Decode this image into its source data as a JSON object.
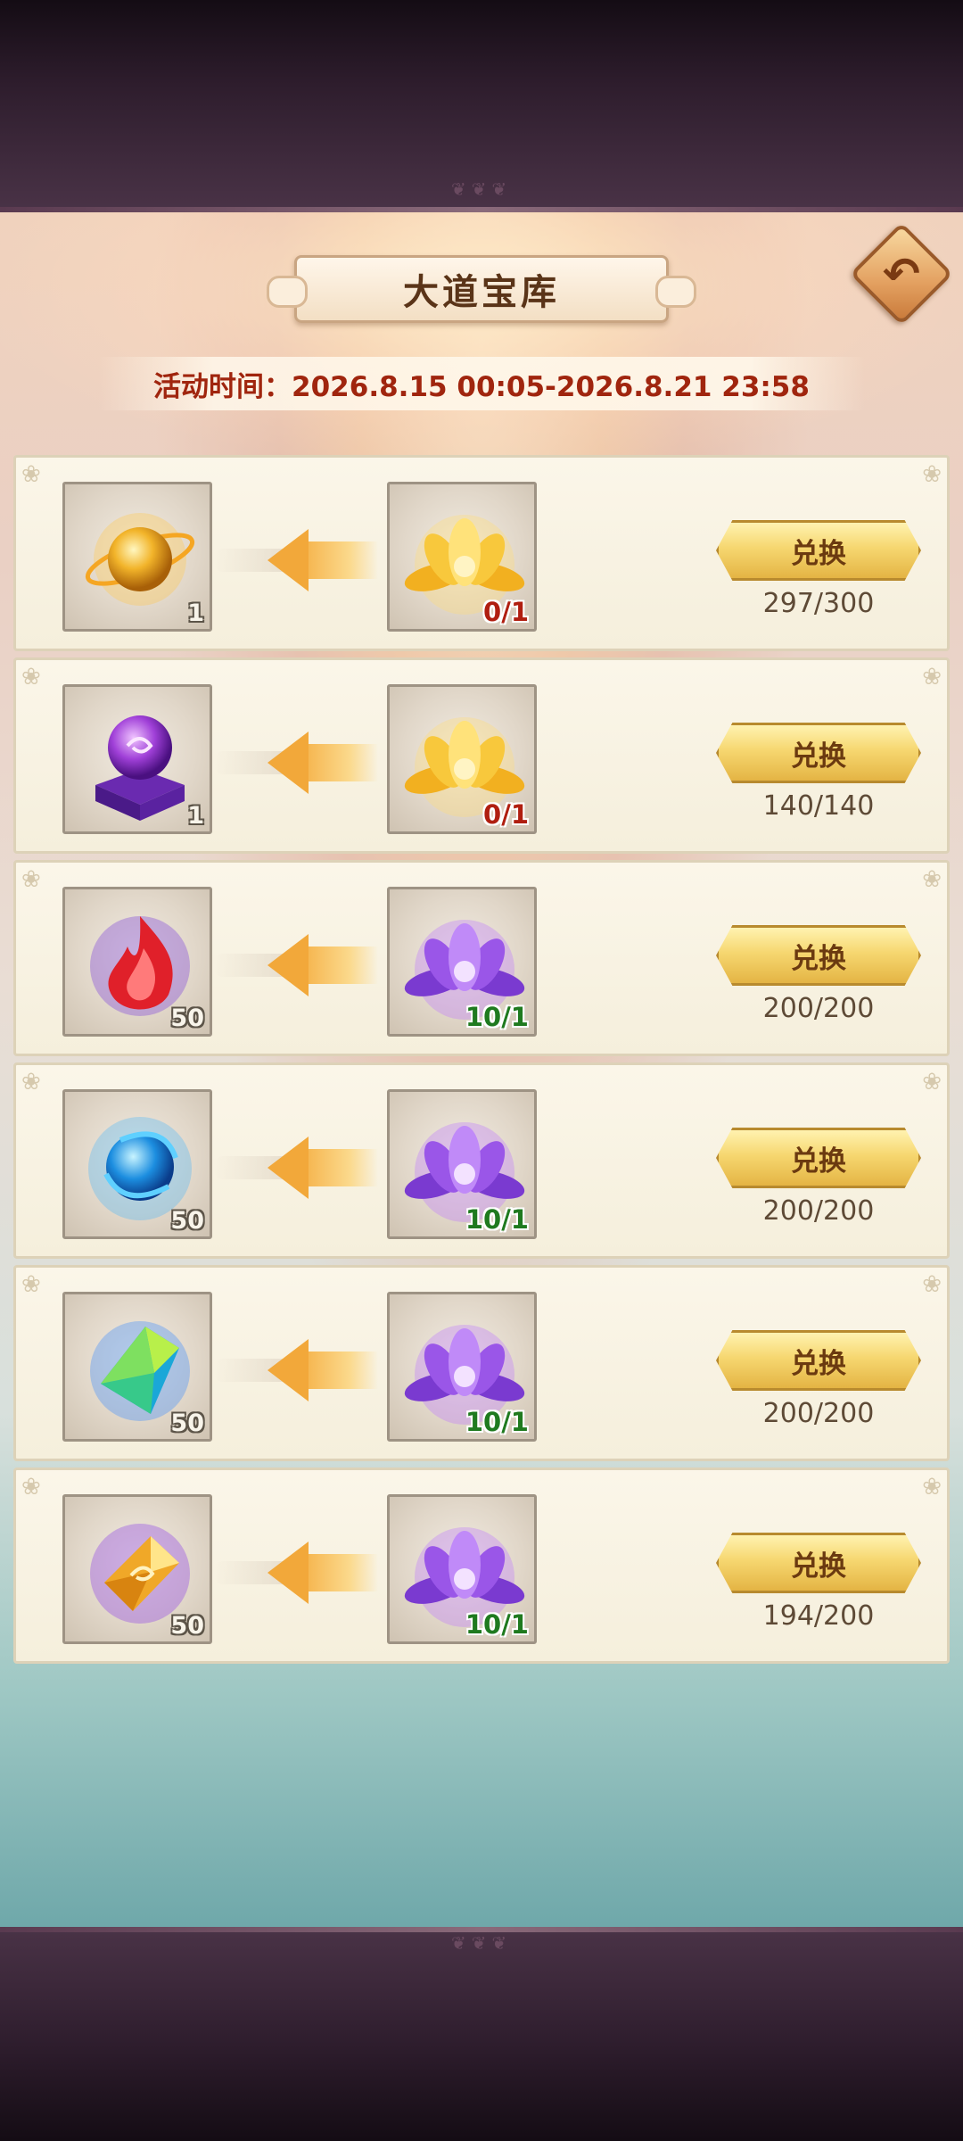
{
  "header": {
    "title": "大道宝库",
    "event_time": "活动时间：2026.8.15 00:05-2026.8.21 23:58",
    "back_glyph": "↶"
  },
  "rows": [
    {
      "reward_qty": "1",
      "cost_qty": "0/1",
      "cost_state": "insufficient",
      "button": "兑换",
      "progress": "297/300"
    },
    {
      "reward_qty": "1",
      "cost_qty": "0/1",
      "cost_state": "insufficient",
      "button": "兑换",
      "progress": "140/140"
    },
    {
      "reward_qty": "50",
      "cost_qty": "10/1",
      "cost_state": "sufficient",
      "button": "兑换",
      "progress": "200/200"
    },
    {
      "reward_qty": "50",
      "cost_qty": "10/1",
      "cost_state": "sufficient",
      "button": "兑换",
      "progress": "200/200"
    },
    {
      "reward_qty": "50",
      "cost_qty": "10/1",
      "cost_state": "sufficient",
      "button": "兑换",
      "progress": "200/200"
    },
    {
      "reward_qty": "50",
      "cost_qty": "10/1",
      "cost_state": "sufficient",
      "button": "兑换",
      "progress": "194/200"
    }
  ],
  "items": {
    "reward_icons": [
      "golden-orb-icon",
      "purple-orb-on-stand-icon",
      "red-flame-crystal-icon",
      "blue-swirl-orb-icon",
      "green-crystal-icon",
      "golden-gem-icon"
    ],
    "cost_icons": [
      "golden-lotus-icon",
      "golden-lotus-icon",
      "purple-lotus-icon",
      "purple-lotus-icon",
      "purple-lotus-icon",
      "purple-lotus-icon"
    ]
  },
  "colors": {
    "insufficient": "#b01e10",
    "sufficient": "#1f7a1f",
    "button_gold": "#f6d770",
    "title_brown": "#5a3418"
  }
}
